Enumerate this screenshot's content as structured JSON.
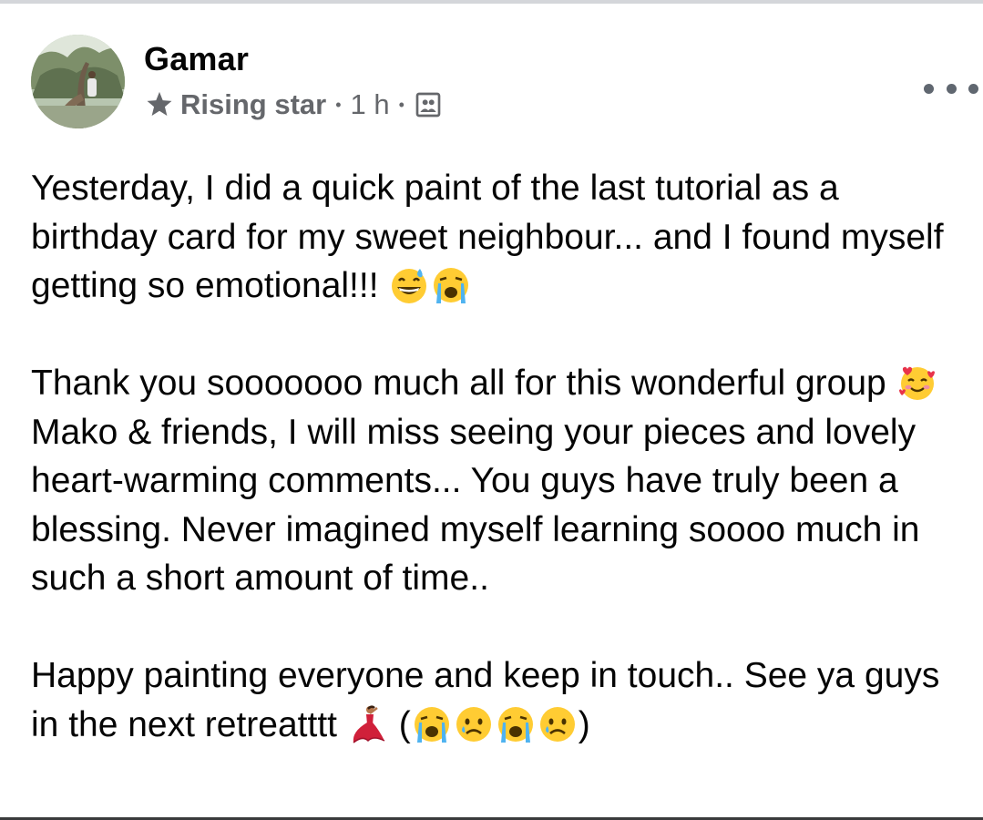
{
  "post": {
    "author": {
      "name": "Gamar",
      "badge": "Rising star",
      "time": "1 h",
      "separator": "•"
    },
    "text": {
      "p1": "Yesterday, I did a quick paint of the last tutorial as a birthday card for my sweet neighbour... and I found myself getting so emotional!!!",
      "p2a": "Thank you sooooooo much all for this wonderful group",
      "p2b": "Mako & friends, I will miss seeing your pieces and lovely heart-warming comments... You guys have truly been a blessing. Never imagined myself learning soooo much in such a short amount of time..",
      "p3a": "Happy painting everyone and keep in touch.. See ya guys in the next retreatttt",
      "p3_open": "(",
      "p3_close": ")"
    },
    "icons": {
      "badge": "star-icon",
      "audience": "group-audience-icon",
      "more": "more-options-icon",
      "emoji": [
        "grinning-sweat-emoji",
        "loudly-crying-emoji",
        "smiling-hearts-emoji",
        "dancer-emoji",
        "loudly-crying-emoji",
        "sad-emoji",
        "loudly-crying-emoji",
        "sad-emoji"
      ]
    }
  },
  "colors": {
    "text": "#050505",
    "meta": "#65676b",
    "emoji_yellow": "#ffcc33",
    "tears": "#4fb3f0",
    "heart": "#e8334a",
    "dress": "#d0203a"
  }
}
